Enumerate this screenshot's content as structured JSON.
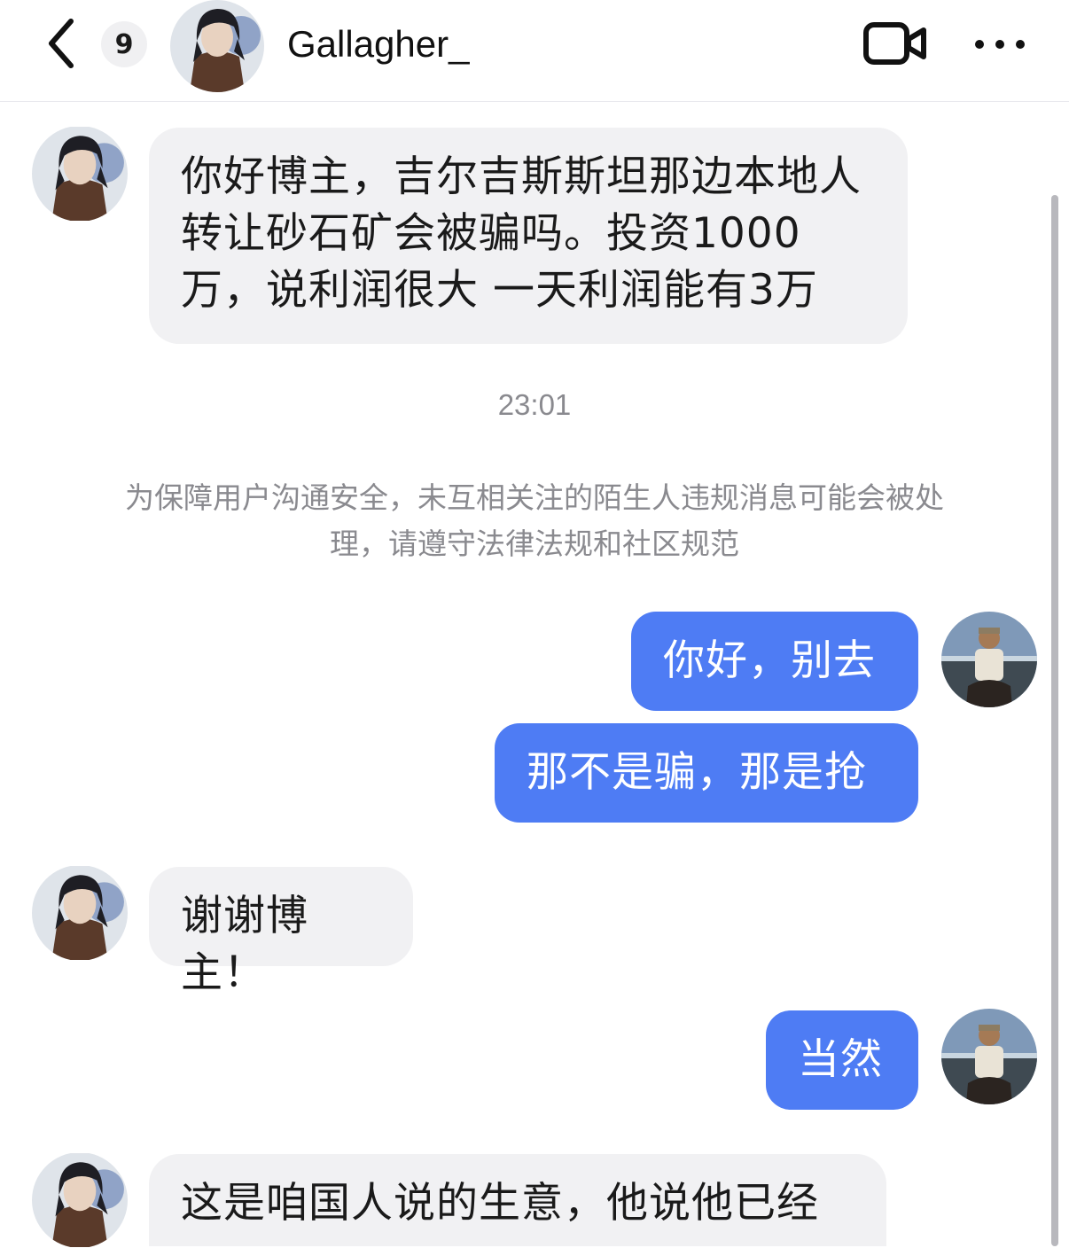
{
  "header": {
    "unread_count": "9",
    "contact_name": "Gallagher_"
  },
  "messages": [
    {
      "side": "in",
      "text": "你好博主，吉尔吉斯斯坦那边本地人转让砂石矿会被骗吗。投资1000万，说利润很大 一天利润能有3万"
    },
    {
      "side": "out",
      "text": "你好，别去"
    },
    {
      "side": "out",
      "text": "那不是骗，那是抢"
    },
    {
      "side": "in",
      "text": "谢谢博主！"
    },
    {
      "side": "out",
      "text": "当然"
    },
    {
      "side": "in",
      "text": "这是咱国人说的生意，他说他已经"
    }
  ],
  "timestamp": "23:01",
  "notice": "为保障用户沟通安全，未互相关注的陌生人违规消息可能会被处理，请遵守法律法规和社区规范",
  "colors": {
    "outgoing_bubble": "#4e7cf4",
    "incoming_bubble": "#f1f1f3",
    "system_text": "#8a8a8f"
  }
}
